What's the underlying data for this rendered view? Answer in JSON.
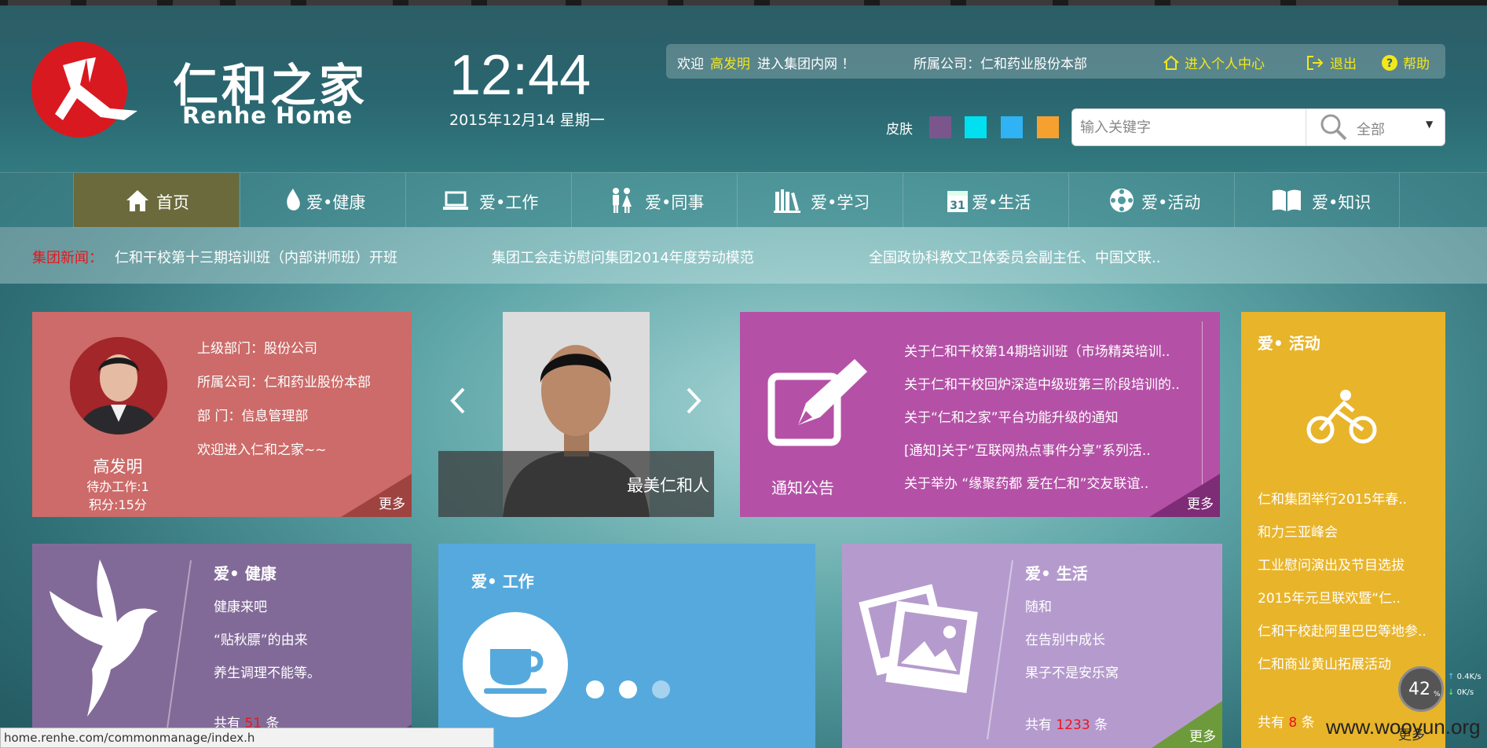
{
  "header": {
    "logo_cn": "仁和之家",
    "logo_en": "Renhe Home",
    "time": "12:44",
    "date": "2015年12月14 星期一",
    "welcome_prefix": "欢迎",
    "user_name": "高发明",
    "welcome_suffix": "进入集团内网 ！",
    "company_label": "所属公司：仁和药业股份本部",
    "personal_center": "进入个人中心",
    "logout": "退出",
    "help": "帮助",
    "skin_label": "皮肤",
    "skin_colors": [
      "#7b568c",
      "#00e0f0",
      "#2fb3f5",
      "#f6a12f"
    ],
    "search_placeholder": "输入关键字",
    "search_scope": "全部"
  },
  "nav": [
    {
      "label": "首页",
      "icon": "home-icon"
    },
    {
      "label": "爱•健康",
      "icon": "flame-icon"
    },
    {
      "label": "爱•工作",
      "icon": "laptop-icon"
    },
    {
      "label": "爱•同事",
      "icon": "people-icon"
    },
    {
      "label": "爱•学习",
      "icon": "books-icon"
    },
    {
      "label": "爱•生活",
      "icon": "calendar-icon"
    },
    {
      "label": "爱•活动",
      "icon": "ball-icon"
    },
    {
      "label": "爱•知识",
      "icon": "book-icon"
    }
  ],
  "ticker": {
    "label": "集团新闻：",
    "items": [
      "仁和干校第十三期培训班（内部讲师班）开班",
      "集团工会走访慰问集团2014年度劳动模范",
      "全国政协科教文卫体委员会副主任、中国文联.."
    ]
  },
  "profile": {
    "dept_parent": "上级部门：股份公司",
    "company": "所属公司：仁和药业股份本部",
    "dept": "部 门：信息管理部",
    "greeting": "欢迎进入仁和之家~~",
    "name": "高发明",
    "todo": "待办工作:1",
    "points": "积分:15分",
    "more": "更多"
  },
  "slider": {
    "caption": "最美仁和人"
  },
  "notice": {
    "title": "通知公告",
    "items": [
      "关于仁和干校第14期培训班（市场精英培训..",
      "关于仁和干校回炉深造中级班第三阶段培训的..",
      "关于“仁和之家”平台功能升级的通知",
      "[通知]关于“互联网热点事件分享”系列活..",
      "关于举办 “缘聚药都 爱在仁和”交友联谊.."
    ],
    "more": "更多"
  },
  "activity": {
    "title": "爱• 活动",
    "items": [
      "仁和集团举行2015年春..",
      "和力三亚峰会",
      "工业慰问演出及节目选拔",
      "2015年元旦联欢暨“仁..",
      "仁和干校赴阿里巴巴等地参..",
      "仁和商业黄山拓展活动"
    ],
    "count_prefix": "共有",
    "count": "8",
    "count_suffix": "条",
    "more": "更多"
  },
  "health": {
    "title": "爱• 健康",
    "items": [
      "健康来吧",
      "“贴秋膘”的由来",
      "养生调理不能等。"
    ],
    "count_prefix": "共有",
    "count": "51",
    "count_suffix": "条"
  },
  "work": {
    "title": "爱• 工作"
  },
  "life": {
    "title": "爱• 生活",
    "items": [
      "随和",
      "在告别中成长",
      "果子不是安乐窝"
    ],
    "count_prefix": "共有",
    "count": "1233",
    "count_suffix": "条",
    "more": "更多"
  },
  "status": {
    "url": "home.renhe.com/commonmanage/index.h",
    "speed_percent": "42",
    "speed_unit": "%",
    "net_up": "0.4K/s",
    "net_down": "0K/s",
    "watermark": "www.wooyun.org"
  }
}
